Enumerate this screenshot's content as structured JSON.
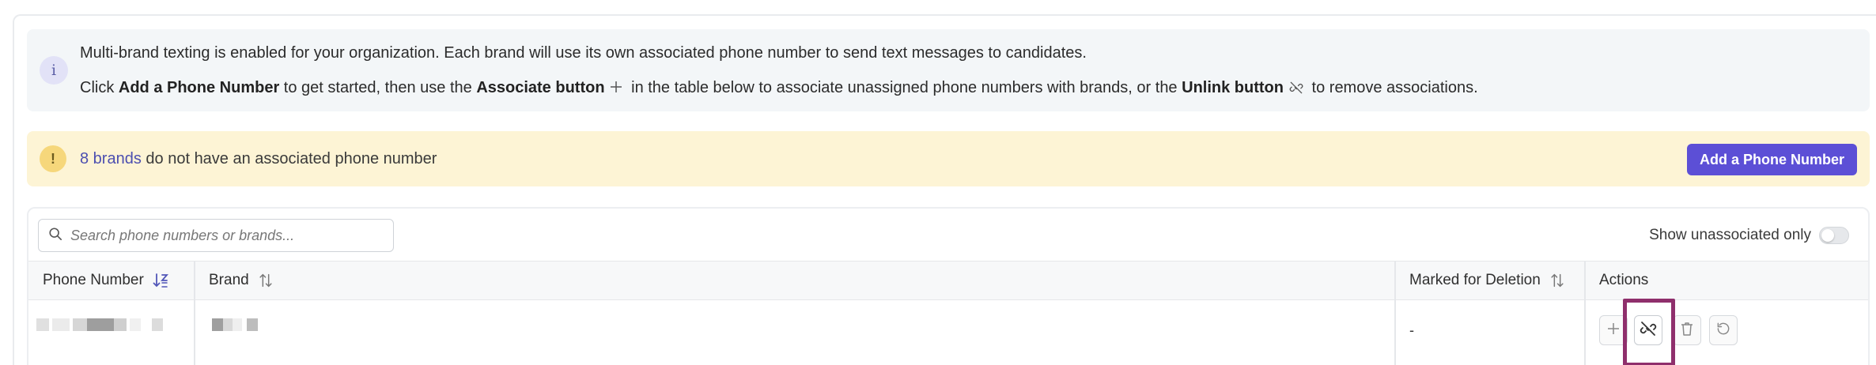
{
  "info": {
    "icon": "info-icon",
    "line1": "Multi-brand texting is enabled for your organization. Each brand will use its own associated phone number to send text messages to candidates.",
    "line2": {
      "part1": "Click ",
      "bold1": "Add a Phone Number",
      "part2": " to get started, then use the ",
      "bold2": "Associate button",
      "plus_icon": "plus-icon",
      "part3": " in the table below to associate unassigned phone numbers with brands, or the ",
      "bold3": "Unlink button",
      "unlink_icon": "unlink-icon",
      "part4": " to remove associations."
    }
  },
  "warning": {
    "icon": "exclamation-icon",
    "count_link": "8 brands",
    "text": " do not have an associated phone number",
    "button_label": "Add a Phone Number"
  },
  "table": {
    "search": {
      "placeholder": "Search phone numbers or brands...",
      "value": ""
    },
    "toggle_label": "Show unassociated only",
    "toggle_on": false,
    "columns": {
      "phone": "Phone Number",
      "brand": "Brand",
      "deletion": "Marked for Deletion",
      "actions": "Actions"
    },
    "rows": [
      {
        "phone": "[redacted]",
        "brand": "[redacted]",
        "marked_for_deletion": "-",
        "actions": [
          "associate-icon",
          "unlink-icon",
          "trash-icon",
          "restore-icon"
        ]
      }
    ]
  },
  "colors": {
    "accent": "#5c4fd6",
    "info_bg": "#f3f6f8",
    "warning_bg": "#fdf4d5",
    "highlight": "#8f2f6c"
  }
}
